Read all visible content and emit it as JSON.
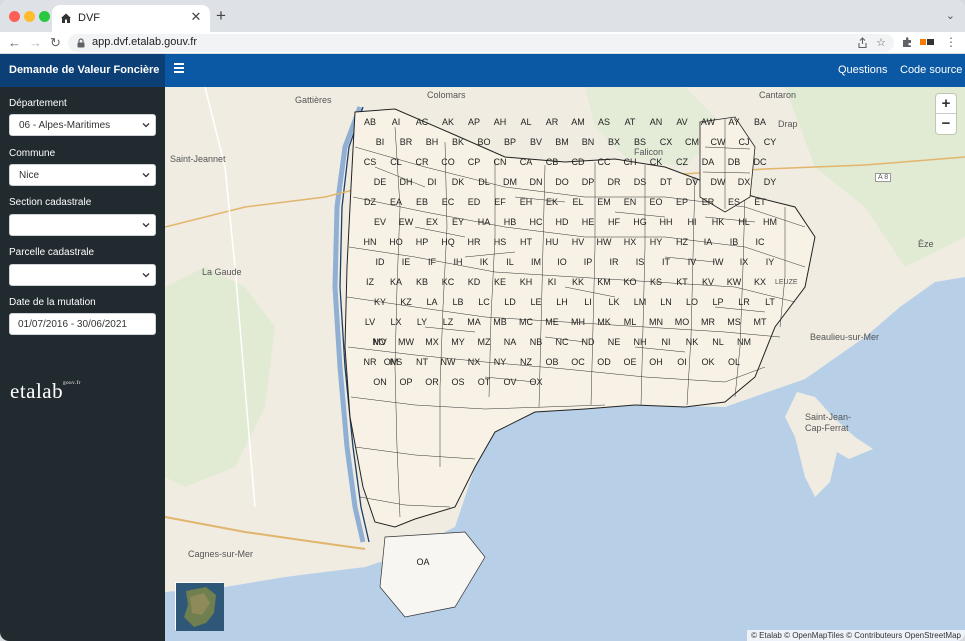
{
  "browser": {
    "tab_title": "DVF",
    "tab_close": "✕",
    "new_tab": "+",
    "tab_menu": "⌄",
    "url": "app.dvf.etalab.gouv.fr",
    "icons": [
      "home-icon",
      "lock-icon",
      "share-icon",
      "star-icon",
      "extension-icon",
      "menu-dots-icon"
    ]
  },
  "header": {
    "brand": "Demande de Valeur Foncière",
    "nav": [
      "Questions",
      "Code source"
    ]
  },
  "sidebar": {
    "departement_label": "Département",
    "departement_value": "06 - Alpes-Maritimes",
    "commune_label": "Commune",
    "commune_value": "Nice",
    "section_label": "Section cadastrale",
    "section_value": "",
    "parcelle_label": "Parcelle cadastrale",
    "parcelle_value": "",
    "date_label": "Date de la mutation",
    "date_value": "01/07/2016 - 30/06/2021",
    "logo": "etalab",
    "logo_sup": "gouv.fr"
  },
  "map": {
    "places": [
      "Gattières",
      "Colomars",
      "Cantaron",
      "Saint-Jeannet",
      "Falicon",
      "Drap",
      "La Gaude",
      "Èze",
      "Beaulieu-sur-Mer",
      "Saint-Jean-Cap-Ferrat",
      "Cagnes-sur-Mer",
      "LEUZE",
      "A 8"
    ],
    "zoom_in": "+",
    "zoom_out": "−",
    "attribution": "© Etalab © OpenMapTiles © Contributeurs OpenStreetMap",
    "sections": [
      "AB",
      "AI",
      "AC",
      "AK",
      "AP",
      "AH",
      "AL",
      "AR",
      "AM",
      "AS",
      "AT",
      "AN",
      "AV",
      "AW",
      "AY",
      "BA",
      "BI",
      "BR",
      "BH",
      "BK",
      "BO",
      "BP",
      "BV",
      "BM",
      "BN",
      "BX",
      "BS",
      "CX",
      "CM",
      "CW",
      "CJ",
      "CY",
      "CS",
      "CL",
      "CR",
      "CO",
      "CP",
      "CN",
      "CA",
      "CB",
      "CD",
      "CC",
      "CH",
      "CK",
      "CZ",
      "DA",
      "DB",
      "DC",
      "DE",
      "DH",
      "DI",
      "DK",
      "DL",
      "DM",
      "DN",
      "DO",
      "DP",
      "DR",
      "DS",
      "DT",
      "DV",
      "DW",
      "DX",
      "DY",
      "DZ",
      "EA",
      "EB",
      "EC",
      "ED",
      "EF",
      "EH",
      "EK",
      "EL",
      "EM",
      "EN",
      "EO",
      "EP",
      "ER",
      "ES",
      "ET",
      "EV",
      "EW",
      "EX",
      "EY",
      "HA",
      "HB",
      "HC",
      "HD",
      "HE",
      "HF",
      "HG",
      "HH",
      "HI",
      "HK",
      "HL",
      "HM",
      "HN",
      "HO",
      "HP",
      "HQ",
      "HR",
      "HS",
      "HT",
      "HU",
      "HV",
      "HW",
      "HX",
      "HY",
      "HZ",
      "IA",
      "IB",
      "IC",
      "ID",
      "IE",
      "IF",
      "IH",
      "IK",
      "IL",
      "IM",
      "IO",
      "IP",
      "IR",
      "IS",
      "IT",
      "IV",
      "IW",
      "IX",
      "IY",
      "IZ",
      "KA",
      "KB",
      "KC",
      "KD",
      "KE",
      "KH",
      "KI",
      "KK",
      "KM",
      "KO",
      "KS",
      "KT",
      "KV",
      "KW",
      "KX",
      "KY",
      "KZ",
      "LA",
      "LB",
      "LC",
      "LD",
      "LE",
      "LH",
      "LI",
      "LK",
      "LM",
      "LN",
      "LO",
      "LP",
      "LR",
      "LT",
      "LV",
      "LX",
      "LY",
      "LZ",
      "MA",
      "MB",
      "MC",
      "ME",
      "MH",
      "MK",
      "ML",
      "MN",
      "MO",
      "MR",
      "MS",
      "MT",
      "MV",
      "MW",
      "MX",
      "MY",
      "MZ",
      "NA",
      "NB",
      "NC",
      "ND",
      "NE",
      "NH",
      "NI",
      "NK",
      "NL",
      "NM",
      "NO",
      "NR",
      "NS",
      "NT",
      "NW",
      "NX",
      "NY",
      "NZ",
      "OA",
      "OB",
      "OC",
      "OD",
      "OE",
      "OH",
      "OI",
      "OK",
      "OL",
      "OM",
      "ON",
      "OP",
      "OR",
      "OS",
      "OT",
      "OV",
      "OX"
    ]
  }
}
